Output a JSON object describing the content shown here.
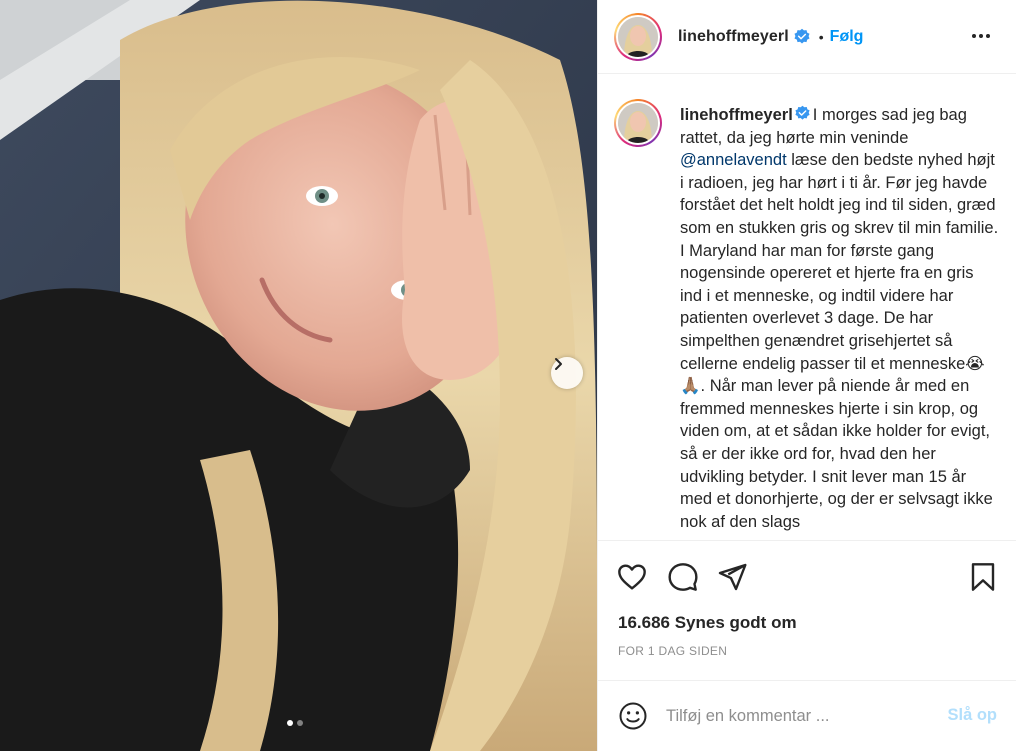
{
  "post": {
    "image_alt": "",
    "carousel": {
      "count": 2,
      "active_index": 0
    }
  },
  "header": {
    "username": "linehoffmeyerl",
    "verified": true,
    "separator": "•",
    "follow_label": "Følg",
    "more_icon": "more-horizontal-icon"
  },
  "caption": {
    "username": "linehoffmeyerl",
    "text_before_mention": "I morges sad jeg bag rattet, da jeg hørte min veninde ",
    "mention": "@annelavendt",
    "text_after_mention": " læse den bedste nyhed højt i radioen, jeg har hørt i ti år. Før jeg havde forstået det helt holdt jeg ind til siden, græd som en stukken gris og skrev til min familie. I Maryland har man for første gang nogensinde opereret et hjerte fra en gris ind i et menneske, og indtil videre har patienten overlevet 3 dage. De har simpelthen genændret grisehjertet så cellerne endelig passer til et menneske",
    "emojis": "😭🙏🏽",
    "text_after_emojis": ". Når man lever på niende år med en fremmed menneskes hjerte i sin krop, og viden om, at et sådan ikke holder for evigt, så er der ikke ord for, hvad den her udvikling betyder. I snit lever man 15 år med et donorhjerte, og der er selvsagt ikke nok af den slags"
  },
  "actions": {
    "like_icon": "heart-icon",
    "comment_icon": "comment-icon",
    "share_icon": "paper-plane-icon",
    "save_icon": "bookmark-icon"
  },
  "likes_text": "16.686 Synes godt om",
  "timestamp": "FOR 1 DAG SIDEN",
  "comment_box": {
    "emoji_icon": "smiley-icon",
    "placeholder": "Tilføj en kommentar ...",
    "post_label": "Slå op"
  },
  "colors": {
    "link_blue": "#0095f6",
    "mention_blue": "#00376b",
    "muted": "#8e8e8e",
    "post_disabled": "#b2dffc",
    "verified_badge": "#3897f0"
  }
}
